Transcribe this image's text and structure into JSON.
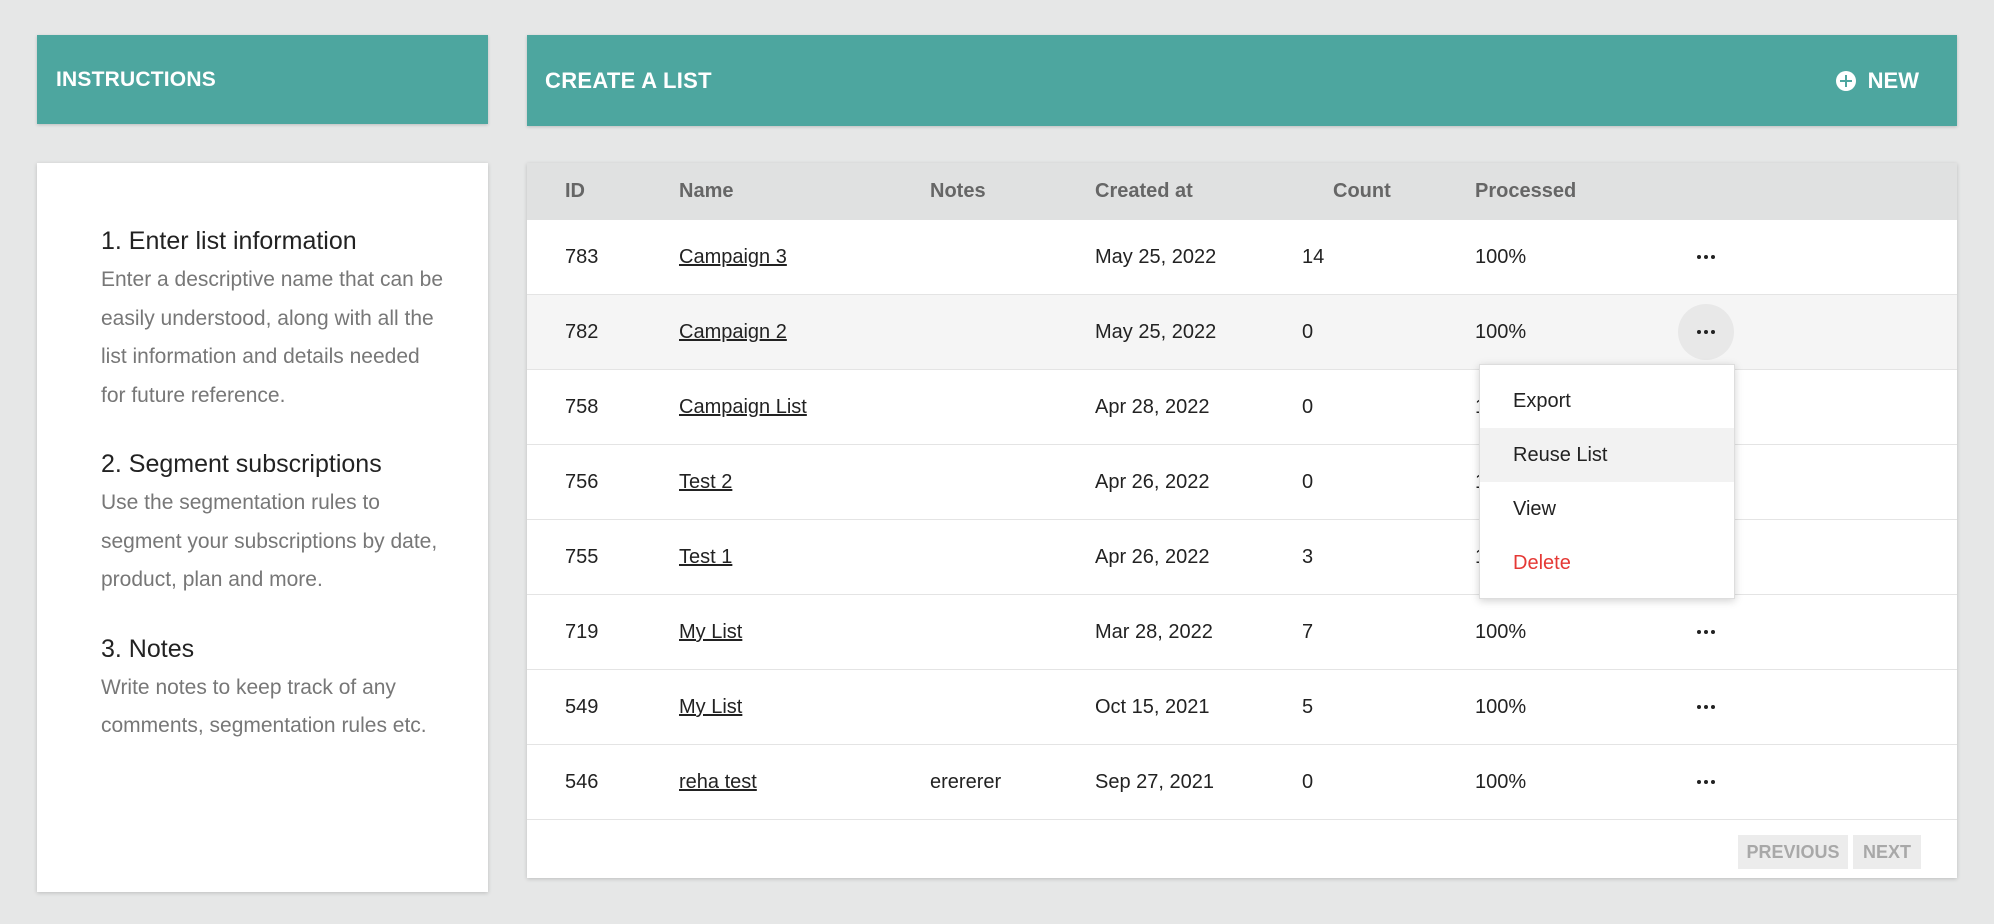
{
  "instructions": {
    "header": "INSTRUCTIONS",
    "steps": [
      {
        "title": "1. Enter list information",
        "text": "Enter a descriptive name that can be easily understood, along with all the list information and details needed for future reference."
      },
      {
        "title": "2. Segment subscriptions",
        "text": "Use the segmentation rules to segment your subscriptions by date, product, plan and more."
      },
      {
        "title": "3. Notes",
        "text": "Write notes to keep track of any comments, segmentation rules etc."
      }
    ]
  },
  "list": {
    "title": "CREATE A LIST",
    "new_label": "NEW",
    "columns": {
      "id": "ID",
      "name": "Name",
      "notes": "Notes",
      "created_at": "Created at",
      "count": "Count",
      "processed": "Processed"
    },
    "rows": [
      {
        "id": "783",
        "name": "Campaign 3",
        "notes": "",
        "created_at": "May 25, 2022",
        "count": "14",
        "processed": "100%"
      },
      {
        "id": "782",
        "name": "Campaign 2",
        "notes": "",
        "created_at": "May 25, 2022",
        "count": "0",
        "processed": "100%"
      },
      {
        "id": "758",
        "name": "Campaign List",
        "notes": "",
        "created_at": "Apr 28, 2022",
        "count": "0",
        "processed": "1"
      },
      {
        "id": "756",
        "name": "Test 2",
        "notes": "",
        "created_at": "Apr 26, 2022",
        "count": "0",
        "processed": "1"
      },
      {
        "id": "755",
        "name": "Test 1",
        "notes": "",
        "created_at": "Apr 26, 2022",
        "count": "3",
        "processed": "1"
      },
      {
        "id": "719",
        "name": "My List",
        "notes": "",
        "created_at": "Mar 28, 2022",
        "count": "7",
        "processed": "100%"
      },
      {
        "id": "549",
        "name": "My List",
        "notes": "",
        "created_at": "Oct 15, 2021",
        "count": "5",
        "processed": "100%"
      },
      {
        "id": "546",
        "name": "reha test",
        "notes": "erererer",
        "created_at": "Sep 27, 2021",
        "count": "0",
        "processed": "100%"
      }
    ],
    "pagination": {
      "previous": "PREVIOUS",
      "next": "NEXT"
    },
    "row_menu": {
      "items": [
        {
          "label": "Export"
        },
        {
          "label": "Reuse List"
        },
        {
          "label": "View"
        },
        {
          "label": "Delete"
        }
      ]
    }
  },
  "colors": {
    "accent": "#4da69f",
    "danger": "#e53935",
    "header_bg": "#e0e1e1"
  },
  "icons": {
    "new": "plus-circle-icon",
    "row_actions": "more-horizontal-icon"
  }
}
